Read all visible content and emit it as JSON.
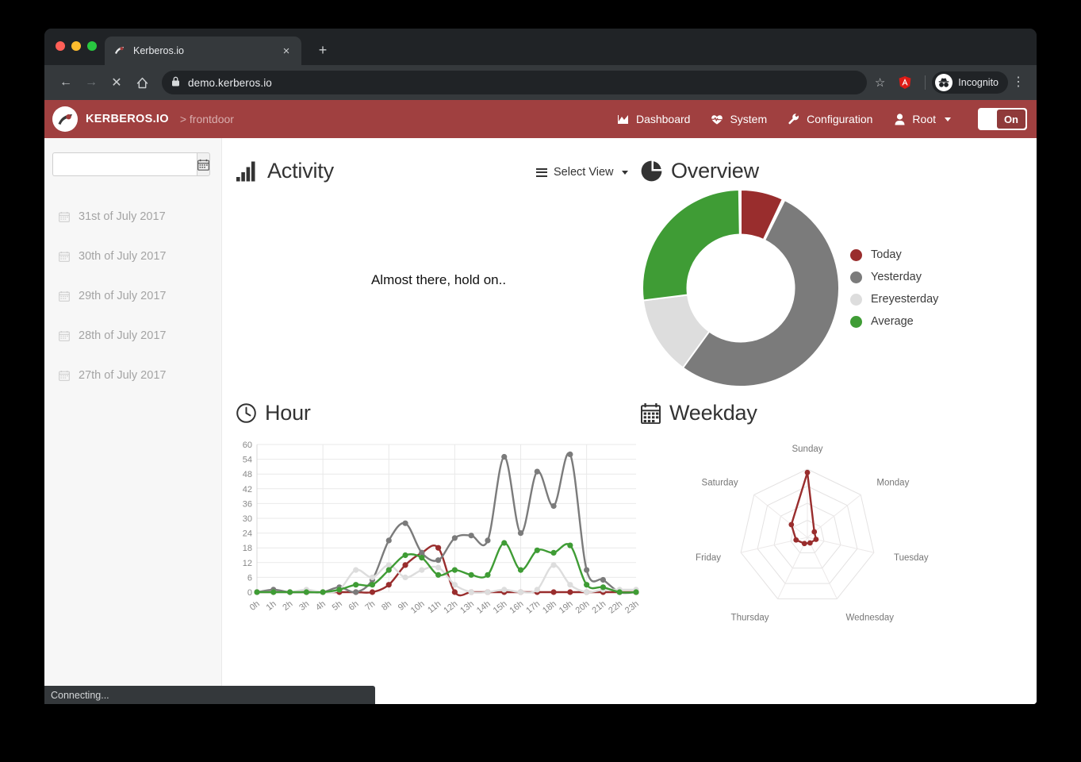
{
  "browser": {
    "tab_title": "Kerberos.io",
    "tab_favicon": "kerberos-favicon-icon",
    "close_tab": "×",
    "new_tab": "+",
    "back": "←",
    "forward": "→",
    "stop": "✕",
    "home": "⌂",
    "lock": "🔒",
    "url": "demo.kerberos.io",
    "star": "☆",
    "extension": "angular-extension-icon",
    "profile_label": "Incognito",
    "menu": "⋮"
  },
  "navbar": {
    "brand": "KERBEROS.IO",
    "brand_sub": "> frontdoor",
    "items": [
      {
        "label": "Dashboard",
        "icon": "chart-area-icon"
      },
      {
        "label": "System",
        "icon": "heartbeat-icon"
      },
      {
        "label": "Configuration",
        "icon": "wrench-icon"
      },
      {
        "label": "Root",
        "icon": "user-icon",
        "caret": true
      }
    ],
    "toggle_label": "On",
    "brand_color": "#a04040"
  },
  "sidebar": {
    "date_input_value": "",
    "date_input_placeholder": "",
    "calendar_icon": "calendar-icon",
    "dates": [
      "31st of July 2017",
      "30th of July 2017",
      "29th of July 2017",
      "28th of July 2017",
      "27th of July 2017"
    ]
  },
  "main": {
    "activity": {
      "title": "Activity",
      "icon": "bar-chart-icon",
      "loading_message": "Almost there, hold on.."
    },
    "select_view": {
      "label": "Select View",
      "icon": "hamburger-icon"
    },
    "overview": {
      "title": "Overview",
      "icon": "pie-chart-icon"
    },
    "hour": {
      "title": "Hour",
      "icon": "clock-icon"
    },
    "weekday": {
      "title": "Weekday",
      "icon": "calendar-grid-icon"
    }
  },
  "statusbar": {
    "text": "Connecting..."
  },
  "colors": {
    "today": "#992d2d",
    "yesterday": "#7b7b7b",
    "ereyesterday": "#dddddd",
    "average": "#3f9c35",
    "brand": "#a04040"
  },
  "chart_data": [
    {
      "type": "pie",
      "title": "Overview",
      "subtype": "donut",
      "legend_position": "right",
      "labels": [
        "Today",
        "Yesterday",
        "Ereyesterday",
        "Average"
      ],
      "values": [
        7,
        53,
        13,
        27
      ],
      "colors": [
        "#992d2d",
        "#7b7b7b",
        "#dddddd",
        "#3f9c35"
      ]
    },
    {
      "type": "line",
      "title": "Hour",
      "xlabel": "",
      "ylabel": "",
      "grid": true,
      "ylim": [
        0,
        60
      ],
      "yticks": [
        0,
        6,
        12,
        18,
        24,
        30,
        36,
        42,
        48,
        54,
        60
      ],
      "categories": [
        "0h",
        "1h",
        "2h",
        "3h",
        "4h",
        "5h",
        "6h",
        "7h",
        "8h",
        "9h",
        "10h",
        "11h",
        "12h",
        "13h",
        "14h",
        "15h",
        "16h",
        "17h",
        "18h",
        "19h",
        "20h",
        "21h",
        "22h",
        "23h"
      ],
      "series": [
        {
          "name": "Today",
          "color": "#992d2d",
          "values": [
            0,
            0,
            0,
            0,
            0,
            0,
            0,
            0,
            3,
            11,
            16,
            18,
            0,
            0,
            0,
            0,
            0,
            0,
            0,
            0,
            0,
            0,
            0,
            0
          ]
        },
        {
          "name": "Yesterday",
          "color": "#7b7b7b",
          "values": [
            0,
            1,
            0,
            0,
            0,
            2,
            0,
            5,
            21,
            28,
            16,
            13,
            22,
            23,
            21,
            55,
            24,
            49,
            35,
            56,
            9,
            5,
            0,
            0
          ]
        },
        {
          "name": "Ereyesterday",
          "color": "#dddddd",
          "values": [
            0,
            0,
            0,
            1,
            0,
            1,
            9,
            6,
            11,
            6,
            9,
            10,
            3,
            0,
            0,
            1,
            0,
            1,
            11,
            3,
            0,
            1,
            1,
            1
          ]
        },
        {
          "name": "Average",
          "color": "#3f9c35",
          "values": [
            0,
            0,
            0,
            0,
            0,
            1,
            3,
            3,
            9,
            15,
            14,
            7,
            9,
            7,
            7,
            20,
            9,
            17,
            16,
            19,
            3,
            2,
            0,
            0
          ]
        }
      ]
    },
    {
      "type": "radar",
      "title": "Weekday",
      "categories": [
        "Sunday",
        "Monday",
        "Tuesday",
        "Wednesday",
        "Thursday",
        "Friday",
        "Saturday"
      ],
      "rings": 4,
      "max": 1,
      "series": [
        {
          "name": "Today",
          "color": "#992d2d",
          "values": [
            0.95,
            0.13,
            0.13,
            0.09,
            0.1,
            0.17,
            0.3
          ]
        }
      ]
    }
  ]
}
